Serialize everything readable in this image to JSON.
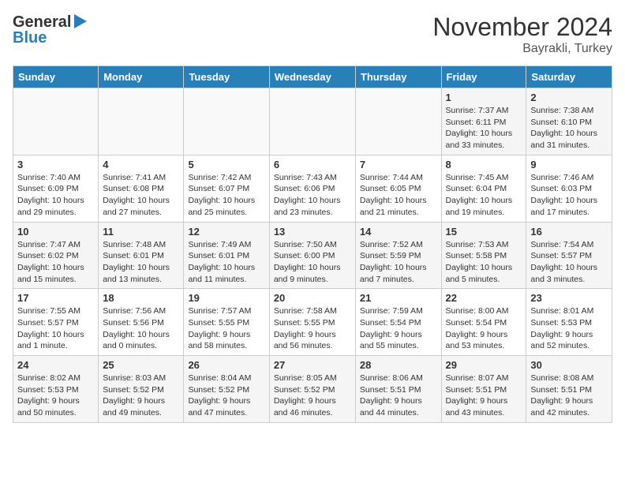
{
  "header": {
    "logo_general": "General",
    "logo_blue": "Blue",
    "title": "November 2024",
    "subtitle": "Bayrakli, Turkey"
  },
  "weekdays": [
    "Sunday",
    "Monday",
    "Tuesday",
    "Wednesday",
    "Thursday",
    "Friday",
    "Saturday"
  ],
  "weeks": [
    [
      {
        "day": "",
        "info": ""
      },
      {
        "day": "",
        "info": ""
      },
      {
        "day": "",
        "info": ""
      },
      {
        "day": "",
        "info": ""
      },
      {
        "day": "",
        "info": ""
      },
      {
        "day": "1",
        "info": "Sunrise: 7:37 AM\nSunset: 6:11 PM\nDaylight: 10 hours and 33 minutes."
      },
      {
        "day": "2",
        "info": "Sunrise: 7:38 AM\nSunset: 6:10 PM\nDaylight: 10 hours and 31 minutes."
      }
    ],
    [
      {
        "day": "3",
        "info": "Sunrise: 7:40 AM\nSunset: 6:09 PM\nDaylight: 10 hours and 29 minutes."
      },
      {
        "day": "4",
        "info": "Sunrise: 7:41 AM\nSunset: 6:08 PM\nDaylight: 10 hours and 27 minutes."
      },
      {
        "day": "5",
        "info": "Sunrise: 7:42 AM\nSunset: 6:07 PM\nDaylight: 10 hours and 25 minutes."
      },
      {
        "day": "6",
        "info": "Sunrise: 7:43 AM\nSunset: 6:06 PM\nDaylight: 10 hours and 23 minutes."
      },
      {
        "day": "7",
        "info": "Sunrise: 7:44 AM\nSunset: 6:05 PM\nDaylight: 10 hours and 21 minutes."
      },
      {
        "day": "8",
        "info": "Sunrise: 7:45 AM\nSunset: 6:04 PM\nDaylight: 10 hours and 19 minutes."
      },
      {
        "day": "9",
        "info": "Sunrise: 7:46 AM\nSunset: 6:03 PM\nDaylight: 10 hours and 17 minutes."
      }
    ],
    [
      {
        "day": "10",
        "info": "Sunrise: 7:47 AM\nSunset: 6:02 PM\nDaylight: 10 hours and 15 minutes."
      },
      {
        "day": "11",
        "info": "Sunrise: 7:48 AM\nSunset: 6:01 PM\nDaylight: 10 hours and 13 minutes."
      },
      {
        "day": "12",
        "info": "Sunrise: 7:49 AM\nSunset: 6:01 PM\nDaylight: 10 hours and 11 minutes."
      },
      {
        "day": "13",
        "info": "Sunrise: 7:50 AM\nSunset: 6:00 PM\nDaylight: 10 hours and 9 minutes."
      },
      {
        "day": "14",
        "info": "Sunrise: 7:52 AM\nSunset: 5:59 PM\nDaylight: 10 hours and 7 minutes."
      },
      {
        "day": "15",
        "info": "Sunrise: 7:53 AM\nSunset: 5:58 PM\nDaylight: 10 hours and 5 minutes."
      },
      {
        "day": "16",
        "info": "Sunrise: 7:54 AM\nSunset: 5:57 PM\nDaylight: 10 hours and 3 minutes."
      }
    ],
    [
      {
        "day": "17",
        "info": "Sunrise: 7:55 AM\nSunset: 5:57 PM\nDaylight: 10 hours and 1 minute."
      },
      {
        "day": "18",
        "info": "Sunrise: 7:56 AM\nSunset: 5:56 PM\nDaylight: 10 hours and 0 minutes."
      },
      {
        "day": "19",
        "info": "Sunrise: 7:57 AM\nSunset: 5:55 PM\nDaylight: 9 hours and 58 minutes."
      },
      {
        "day": "20",
        "info": "Sunrise: 7:58 AM\nSunset: 5:55 PM\nDaylight: 9 hours and 56 minutes."
      },
      {
        "day": "21",
        "info": "Sunrise: 7:59 AM\nSunset: 5:54 PM\nDaylight: 9 hours and 55 minutes."
      },
      {
        "day": "22",
        "info": "Sunrise: 8:00 AM\nSunset: 5:54 PM\nDaylight: 9 hours and 53 minutes."
      },
      {
        "day": "23",
        "info": "Sunrise: 8:01 AM\nSunset: 5:53 PM\nDaylight: 9 hours and 52 minutes."
      }
    ],
    [
      {
        "day": "24",
        "info": "Sunrise: 8:02 AM\nSunset: 5:53 PM\nDaylight: 9 hours and 50 minutes."
      },
      {
        "day": "25",
        "info": "Sunrise: 8:03 AM\nSunset: 5:52 PM\nDaylight: 9 hours and 49 minutes."
      },
      {
        "day": "26",
        "info": "Sunrise: 8:04 AM\nSunset: 5:52 PM\nDaylight: 9 hours and 47 minutes."
      },
      {
        "day": "27",
        "info": "Sunrise: 8:05 AM\nSunset: 5:52 PM\nDaylight: 9 hours and 46 minutes."
      },
      {
        "day": "28",
        "info": "Sunrise: 8:06 AM\nSunset: 5:51 PM\nDaylight: 9 hours and 44 minutes."
      },
      {
        "day": "29",
        "info": "Sunrise: 8:07 AM\nSunset: 5:51 PM\nDaylight: 9 hours and 43 minutes."
      },
      {
        "day": "30",
        "info": "Sunrise: 8:08 AM\nSunset: 5:51 PM\nDaylight: 9 hours and 42 minutes."
      }
    ]
  ]
}
